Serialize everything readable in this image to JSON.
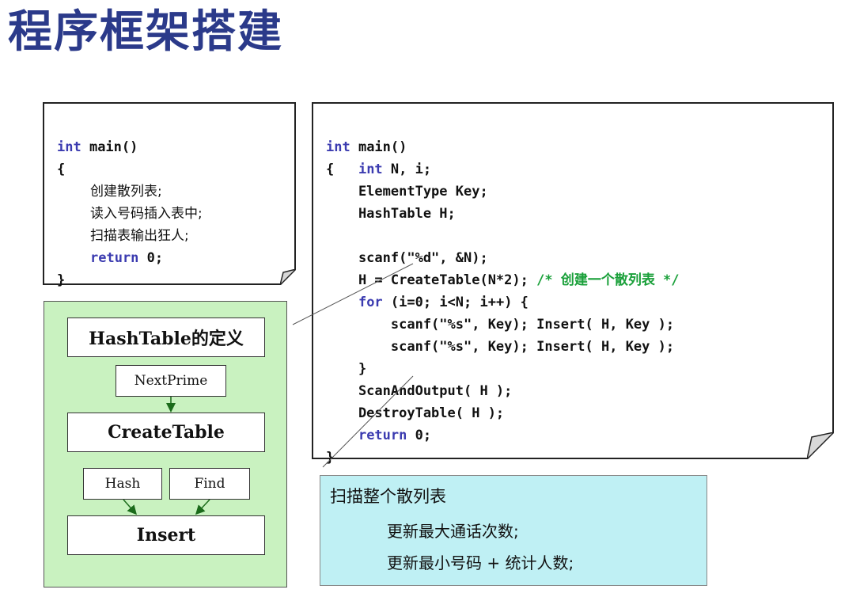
{
  "title": "程序框架搭建",
  "outline_code": {
    "line1_kw": "int",
    "line1_rest": " main()",
    "line2": "{",
    "line3": "创建散列表;",
    "line4": "读入号码插入表中;",
    "line5": "扫描表输出狂人;",
    "line6_kw": "return",
    "line6_rest": " 0;",
    "line7": "}"
  },
  "main_code": {
    "l1_kw": "int",
    "l1_rest": " main()",
    "l2_pre": "{   ",
    "l2_kw": "int",
    "l2_rest": " N, i;",
    "l3": "    ElementType Key;",
    "l4": "    HashTable H;",
    "l5": "",
    "l6": "    scanf(\"%d\", &N);",
    "l7_code": "    H = CreateTable(N*2); ",
    "l7_comment": "/* 创建一个散列表 */",
    "l8_pre": "    ",
    "l8_kw": "for",
    "l8_rest": " (i=0; i<N; i++) {",
    "l9": "        scanf(\"%s\", Key); Insert( H, Key );",
    "l10": "        scanf(\"%s\", Key); Insert( H, Key );",
    "l11": "    }",
    "l12": "    ScanAndOutput( H );",
    "l13": "    DestroyTable( H );",
    "l14_pre": "    ",
    "l14_kw": "return",
    "l14_rest": " 0;",
    "l15": "}"
  },
  "functions": {
    "hashtable_def": "HashTable的定义",
    "nextprime": "NextPrime",
    "createtable": "CreateTable",
    "hash": "Hash",
    "find": "Find",
    "insert": "Insert"
  },
  "scan_note": {
    "heading": "扫描整个散列表",
    "item1": "更新最大通话次数;",
    "item2": "更新最小号码 + 统计人数;"
  },
  "colors": {
    "title": "#2b3a8a",
    "keyword": "#3b3bb0",
    "comment": "#1aa03a",
    "function_panel_bg": "#c9f2c0",
    "scan_note_bg": "#bff0f4"
  }
}
